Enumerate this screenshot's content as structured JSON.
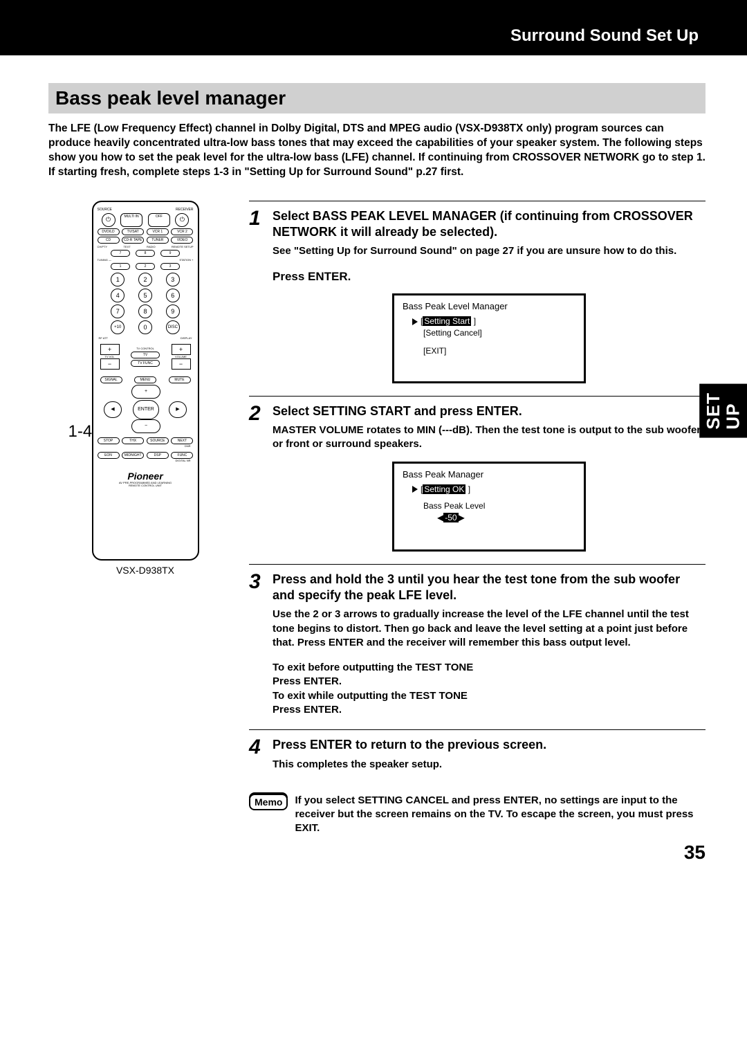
{
  "header": {
    "title": "Surround Sound Set Up"
  },
  "section_title": "Bass peak level manager",
  "intro": "The LFE (Low Frequency Effect) channel in Dolby Digital, DTS and MPEG audio (VSX-D938TX only) program sources can produce heavily concentrated ultra-low bass tones that may exceed the capabilities of your speaker system. The following steps show you how to set the peak level for the ultra-low bass (LFE) channel. If continuing from CROSSOVER NETWORK go to step 1. If starting fresh, complete steps 1-3 in \"Setting Up for Surround Sound\" p.27 first.",
  "remote": {
    "model": "VSX-D938TX",
    "callout": "1-4",
    "brand": "Pioneer",
    "subtext1": "AV PRE-PROGRAMMED AND LEARNING",
    "subtext2": "REMOTE CONTROL UNIT",
    "top_left": "SOURCE",
    "top_right": "RECEIVER",
    "r1": [
      "MULTI IN",
      "OFF"
    ],
    "r2": [
      "DVD/LD",
      "TV/SAT",
      "VCR 1",
      "VCR 2"
    ],
    "r3": [
      "CD",
      "CD-R TAPE",
      "TUNER",
      "VIDEO"
    ],
    "r3b": [
      "CH/PTY",
      "TEXT",
      "RADIO",
      "REMOTE SETUP"
    ],
    "r4": [
      "7",
      "8",
      "9"
    ],
    "tune_l": "TUNING —",
    "tune_r": "STATION +",
    "r5": [
      "1",
      "2",
      "3"
    ],
    "numpad": [
      [
        1,
        2,
        3
      ],
      [
        4,
        5,
        6
      ],
      [
        7,
        8,
        9
      ],
      [
        "+10",
        "0",
        "DISC"
      ]
    ],
    "rfatt": "RF ATT",
    "display": "DISPLAY",
    "tvvol": "TV VOL",
    "tvc": "TV CONTROL",
    "volume": "VOLUME",
    "tv": "TV",
    "tvfunc": "TV FUNC",
    "dpad_top": [
      "SIGNAL",
      "MENU",
      "MUTE"
    ],
    "enter": "ENTER",
    "btns1": [
      "STOP",
      "THX",
      "SOURCE",
      "NEXT"
    ],
    "btns2": [
      "EON",
      "MIDNIGHT",
      "DSP",
      "FUNC"
    ],
    "small1": "DNR",
    "small2": "DIGITAL NR"
  },
  "steps": [
    {
      "num": "1",
      "title": "Select BASS PEAK LEVEL MANAGER (if continuing from  CROSSOVER NETWORK it will already be selected).",
      "sub": "See \"Setting Up for Surround Sound\" on page 27 if you are unsure how to do this.",
      "press": "Press ENTER.",
      "osd": {
        "title": "Bass Peak Level Manager",
        "lines": [
          {
            "cursor": true,
            "sel": "Setting Start",
            "bracket": true,
            "trailing": "   ]"
          },
          {
            "cursor": false,
            "box": "Setting Cancel"
          },
          {
            "cursor": false,
            "plain": "[EXIT]"
          }
        ]
      }
    },
    {
      "num": "2",
      "title": "Select SETTING START and press ENTER.",
      "sub": "MASTER VOLUME rotates to MIN (---dB). Then the test tone is output to the sub woofer or front or surround speakers.",
      "osd": {
        "title": "Bass Peak Manager",
        "lines": [
          {
            "cursor": true,
            "sel": "Setting OK",
            "bracket": true,
            "trailing": "     ]"
          },
          {
            "label": "Bass Peak Level"
          },
          {
            "arrows_sel": "-50"
          }
        ]
      }
    },
    {
      "num": "3",
      "title": "Press and hold the 3  until you hear the test tone from the sub woofer and specify the peak LFE level.",
      "sub": "Use the 2  or 3  arrows to gradually increase the level of the LFE channel until the test tone begins to distort. Then go back and leave the level setting at a point just before that. Press ENTER and the receiver will remember this bass output level.",
      "extra": "To exit before outputting the TEST TONE\nPress ENTER.\nTo exit while outputting the TEST TONE\nPress ENTER."
    },
    {
      "num": "4",
      "title": "Press ENTER to return to the previous screen.",
      "sub": "This completes the speaker setup."
    }
  ],
  "memo": {
    "label": "Memo",
    "text": "If you select SETTING CANCEL and press ENTER, no settings are input to the receiver but the screen remains on the TV. To escape the screen, you must press EXIT."
  },
  "side_tab": "SET\nUP",
  "page_number": "35"
}
